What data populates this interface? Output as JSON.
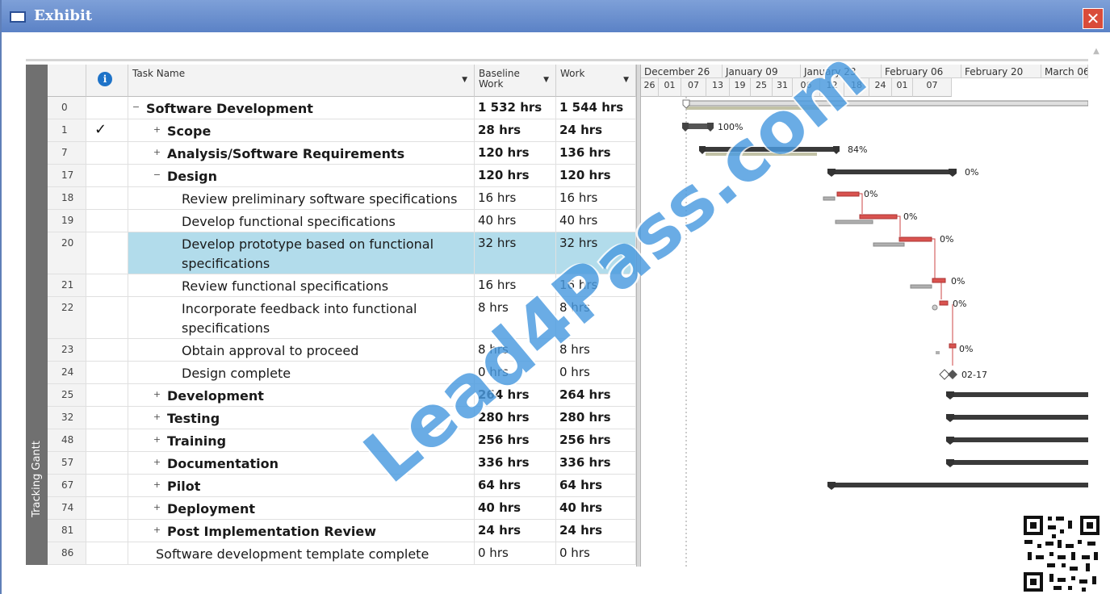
{
  "window": {
    "title": "Exhibit",
    "close_glyph": "✕"
  },
  "view_label": "Tracking Gantt",
  "columns": {
    "indicator_glyph": "i",
    "task_name": "Task Name",
    "baseline_work": "Baseline Work",
    "work": "Work"
  },
  "tasks": [
    {
      "id": "0",
      "name": "Software Development",
      "baseline": "1 532 hrs",
      "work": "1 544 hrs",
      "level": 0,
      "bold": true,
      "expander": "−",
      "check": ""
    },
    {
      "id": "1",
      "name": "Scope",
      "baseline": "28 hrs",
      "work": "24 hrs",
      "level": 1,
      "bold": true,
      "expander": "+",
      "check": "✓"
    },
    {
      "id": "7",
      "name": "Analysis/Software Requirements",
      "baseline": "120 hrs",
      "work": "136 hrs",
      "level": 1,
      "bold": true,
      "expander": "+",
      "check": ""
    },
    {
      "id": "17",
      "name": "Design",
      "baseline": "120 hrs",
      "work": "120 hrs",
      "level": 1,
      "bold": true,
      "expander": "−",
      "check": ""
    },
    {
      "id": "18",
      "name": "Review preliminary software specifications",
      "baseline": "16 hrs",
      "work": "16 hrs",
      "level": 2,
      "bold": false,
      "expander": "",
      "check": ""
    },
    {
      "id": "19",
      "name": "Develop functional specifications",
      "baseline": "40 hrs",
      "work": "40 hrs",
      "level": 2,
      "bold": false,
      "expander": "",
      "check": ""
    },
    {
      "id": "20",
      "name": "Develop prototype based on functional specifications",
      "baseline": "32 hrs",
      "work": "32 hrs",
      "level": 2,
      "bold": false,
      "expander": "",
      "check": "",
      "highlight": true
    },
    {
      "id": "21",
      "name": "Review functional specifications",
      "baseline": "16 hrs",
      "work": "16 hrs",
      "level": 2,
      "bold": false,
      "expander": "",
      "check": ""
    },
    {
      "id": "22",
      "name": "Incorporate feedback into functional specifications",
      "baseline": "8 hrs",
      "work": "8 hrs",
      "level": 2,
      "bold": false,
      "expander": "",
      "check": ""
    },
    {
      "id": "23",
      "name": "Obtain approval to proceed",
      "baseline": "8 hrs",
      "work": "8 hrs",
      "level": 2,
      "bold": false,
      "expander": "",
      "check": ""
    },
    {
      "id": "24",
      "name": "Design complete",
      "baseline": "0 hrs",
      "work": "0 hrs",
      "level": 2,
      "bold": false,
      "expander": "",
      "check": ""
    },
    {
      "id": "25",
      "name": "Development",
      "baseline": "264 hrs",
      "work": "264 hrs",
      "level": 1,
      "bold": true,
      "expander": "+",
      "check": ""
    },
    {
      "id": "32",
      "name": "Testing",
      "baseline": "280 hrs",
      "work": "280 hrs",
      "level": 1,
      "bold": true,
      "expander": "+",
      "check": ""
    },
    {
      "id": "48",
      "name": "Training",
      "baseline": "256 hrs",
      "work": "256 hrs",
      "level": 1,
      "bold": true,
      "expander": "+",
      "check": ""
    },
    {
      "id": "57",
      "name": "Documentation",
      "baseline": "336 hrs",
      "work": "336 hrs",
      "level": 1,
      "bold": true,
      "expander": "+",
      "check": ""
    },
    {
      "id": "67",
      "name": "Pilot",
      "baseline": "64 hrs",
      "work": "64 hrs",
      "level": 1,
      "bold": true,
      "expander": "+",
      "check": ""
    },
    {
      "id": "74",
      "name": "Deployment",
      "baseline": "40 hrs",
      "work": "40 hrs",
      "level": 1,
      "bold": true,
      "expander": "+",
      "check": ""
    },
    {
      "id": "81",
      "name": "Post Implementation Review",
      "baseline": "24 hrs",
      "work": "24 hrs",
      "level": 1,
      "bold": true,
      "expander": "+",
      "check": ""
    },
    {
      "id": "86",
      "name": "Software development template complete",
      "baseline": "0 hrs",
      "work": "0 hrs",
      "level": 1,
      "bold": false,
      "expander": "",
      "check": ""
    }
  ],
  "timeline": {
    "major": [
      "December 26",
      "January 09",
      "January 23",
      "February 06",
      "February 20",
      "March 06"
    ],
    "minor": [
      "26",
      "01",
      "07",
      "13",
      "19",
      "25",
      "31",
      "06",
      "12",
      "18",
      "24",
      "01",
      "07"
    ]
  },
  "bar_labels": {
    "scope": "100%",
    "analysis": "84%",
    "design": "0%",
    "t18": "0%",
    "t19": "0%",
    "t20": "0%",
    "t21": "0%",
    "t22": "0%",
    "t23": "0%",
    "t24_date": "02-17"
  },
  "watermark": "Lead4Pass.com",
  "colors": {
    "titlebar": "#5b82c6",
    "highlight_row": "#b2dceb",
    "critical_bar": "#d9534f",
    "summary_bar": "#3a3a3a",
    "baseline_bar": "#b0b0b0",
    "watermark": "#4a9be0"
  }
}
